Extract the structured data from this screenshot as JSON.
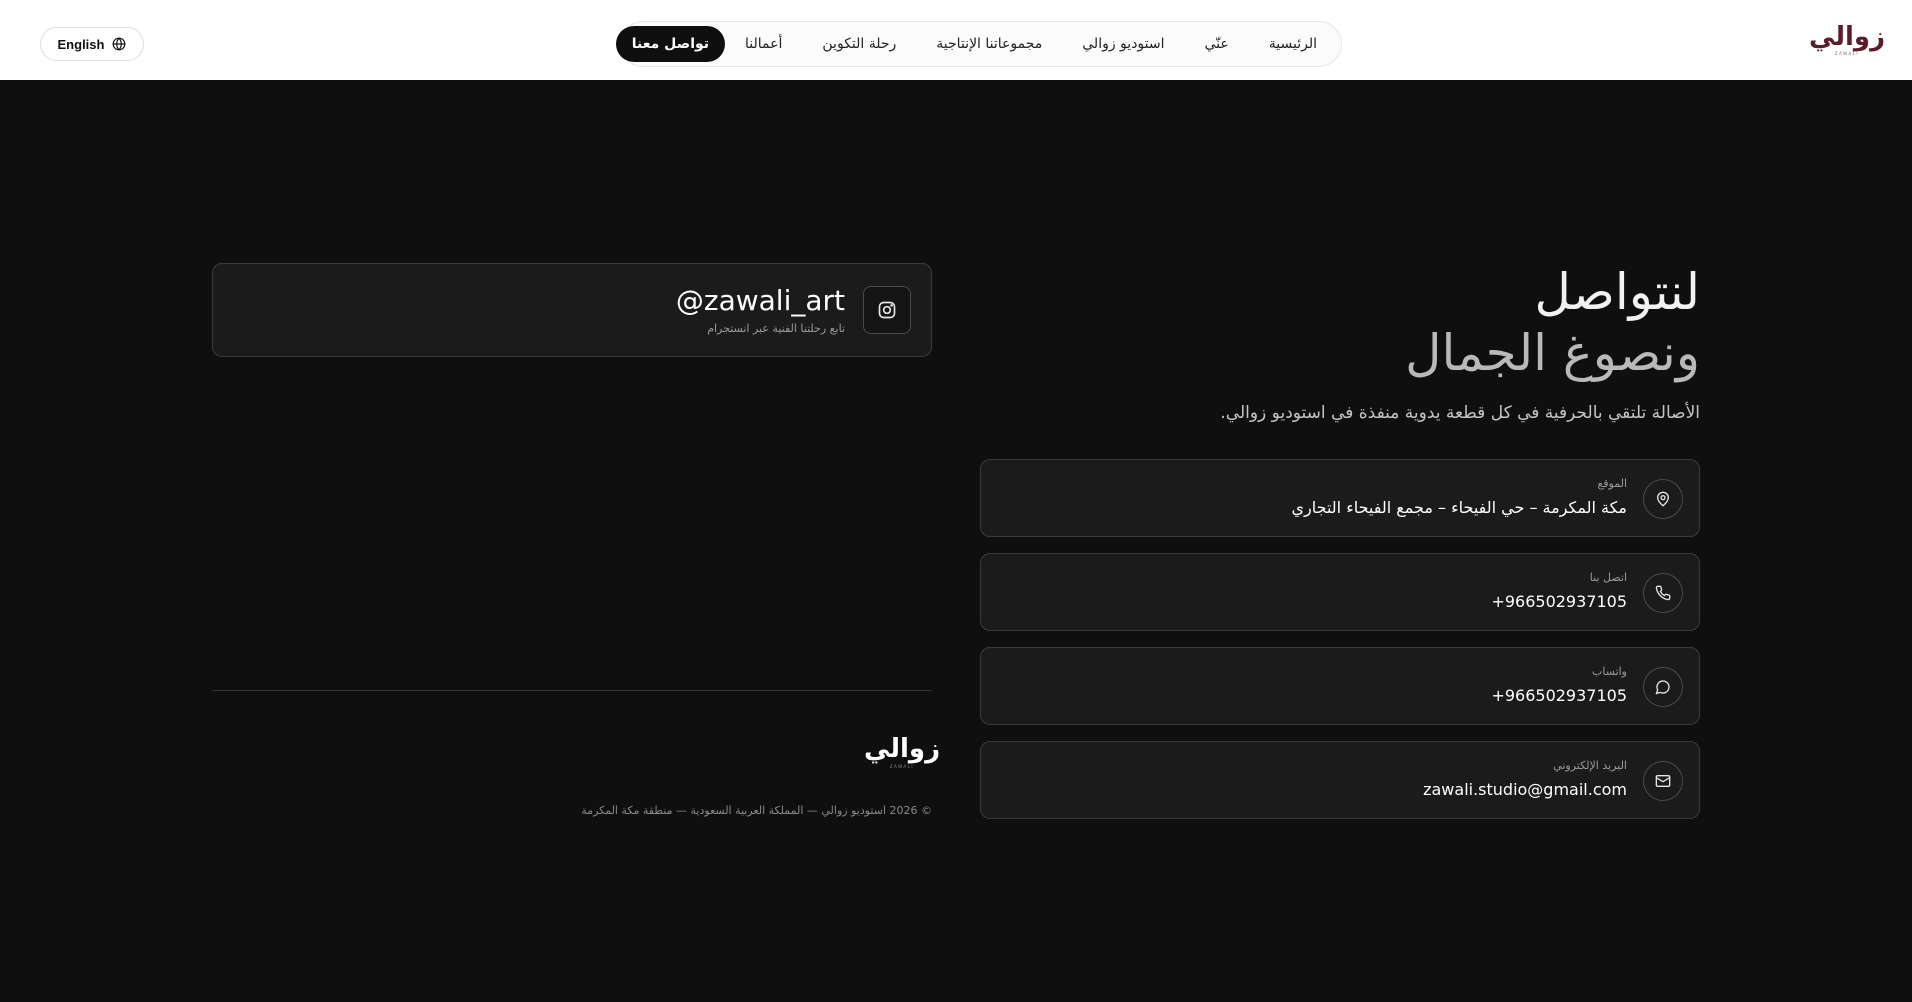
{
  "header": {
    "logo": {
      "mark": "زوالي",
      "sub": "ZAWALI"
    },
    "nav": [
      {
        "label": "الرئيسية"
      },
      {
        "label": "عنّي"
      },
      {
        "label": "استوديو زوالي"
      },
      {
        "label": "مجموعاتنا الإنتاجية"
      },
      {
        "label": "رحلة التكوين"
      },
      {
        "label": "أعمالنا"
      },
      {
        "label": "تواصل معنا",
        "active": true
      }
    ],
    "language_button": {
      "label": "English",
      "icon": "globe-icon"
    }
  },
  "hero": {
    "title_line_1": "لنتواصل",
    "title_line_2": "ونصوغ الجمال",
    "description": "الأصالة تلتقي بالحرفية في كل قطعة يدوية منفذة في استوديو زوالي."
  },
  "contacts": [
    {
      "icon": "map-pin-icon",
      "label": "الموقع",
      "value": "مكة المكرمة – حي الفيحاء – مجمع الفيحاء التجاري"
    },
    {
      "icon": "phone-icon",
      "label": "اتصل بنا",
      "value": "+966502937105"
    },
    {
      "icon": "whatsapp-icon",
      "label": "واتساب",
      "value": "+966502937105"
    },
    {
      "icon": "mail-icon",
      "label": "البريد الإلكتروني",
      "value": "zawali.studio@gmail.com"
    }
  ],
  "instagram": {
    "icon": "instagram-icon",
    "handle": "@zawali_art",
    "subtitle": "تابع رحلتنا الفنية عبر انستجرام"
  },
  "footer": {
    "logo": {
      "mark": "زوالي",
      "sub": "ZAWALI"
    },
    "copyright": "© 2026 استوديو زوالي — المملكة العربية السعودية — منطقة مكة المكرمة"
  },
  "colors": {
    "background": "#0f0f0f",
    "header_bg": "#ffffff",
    "card_bg": "#1b1b1b",
    "card_border": "#3a3a3a",
    "logo_color": "#5b1e2b",
    "nav_active_bg": "#0f0f0f"
  }
}
